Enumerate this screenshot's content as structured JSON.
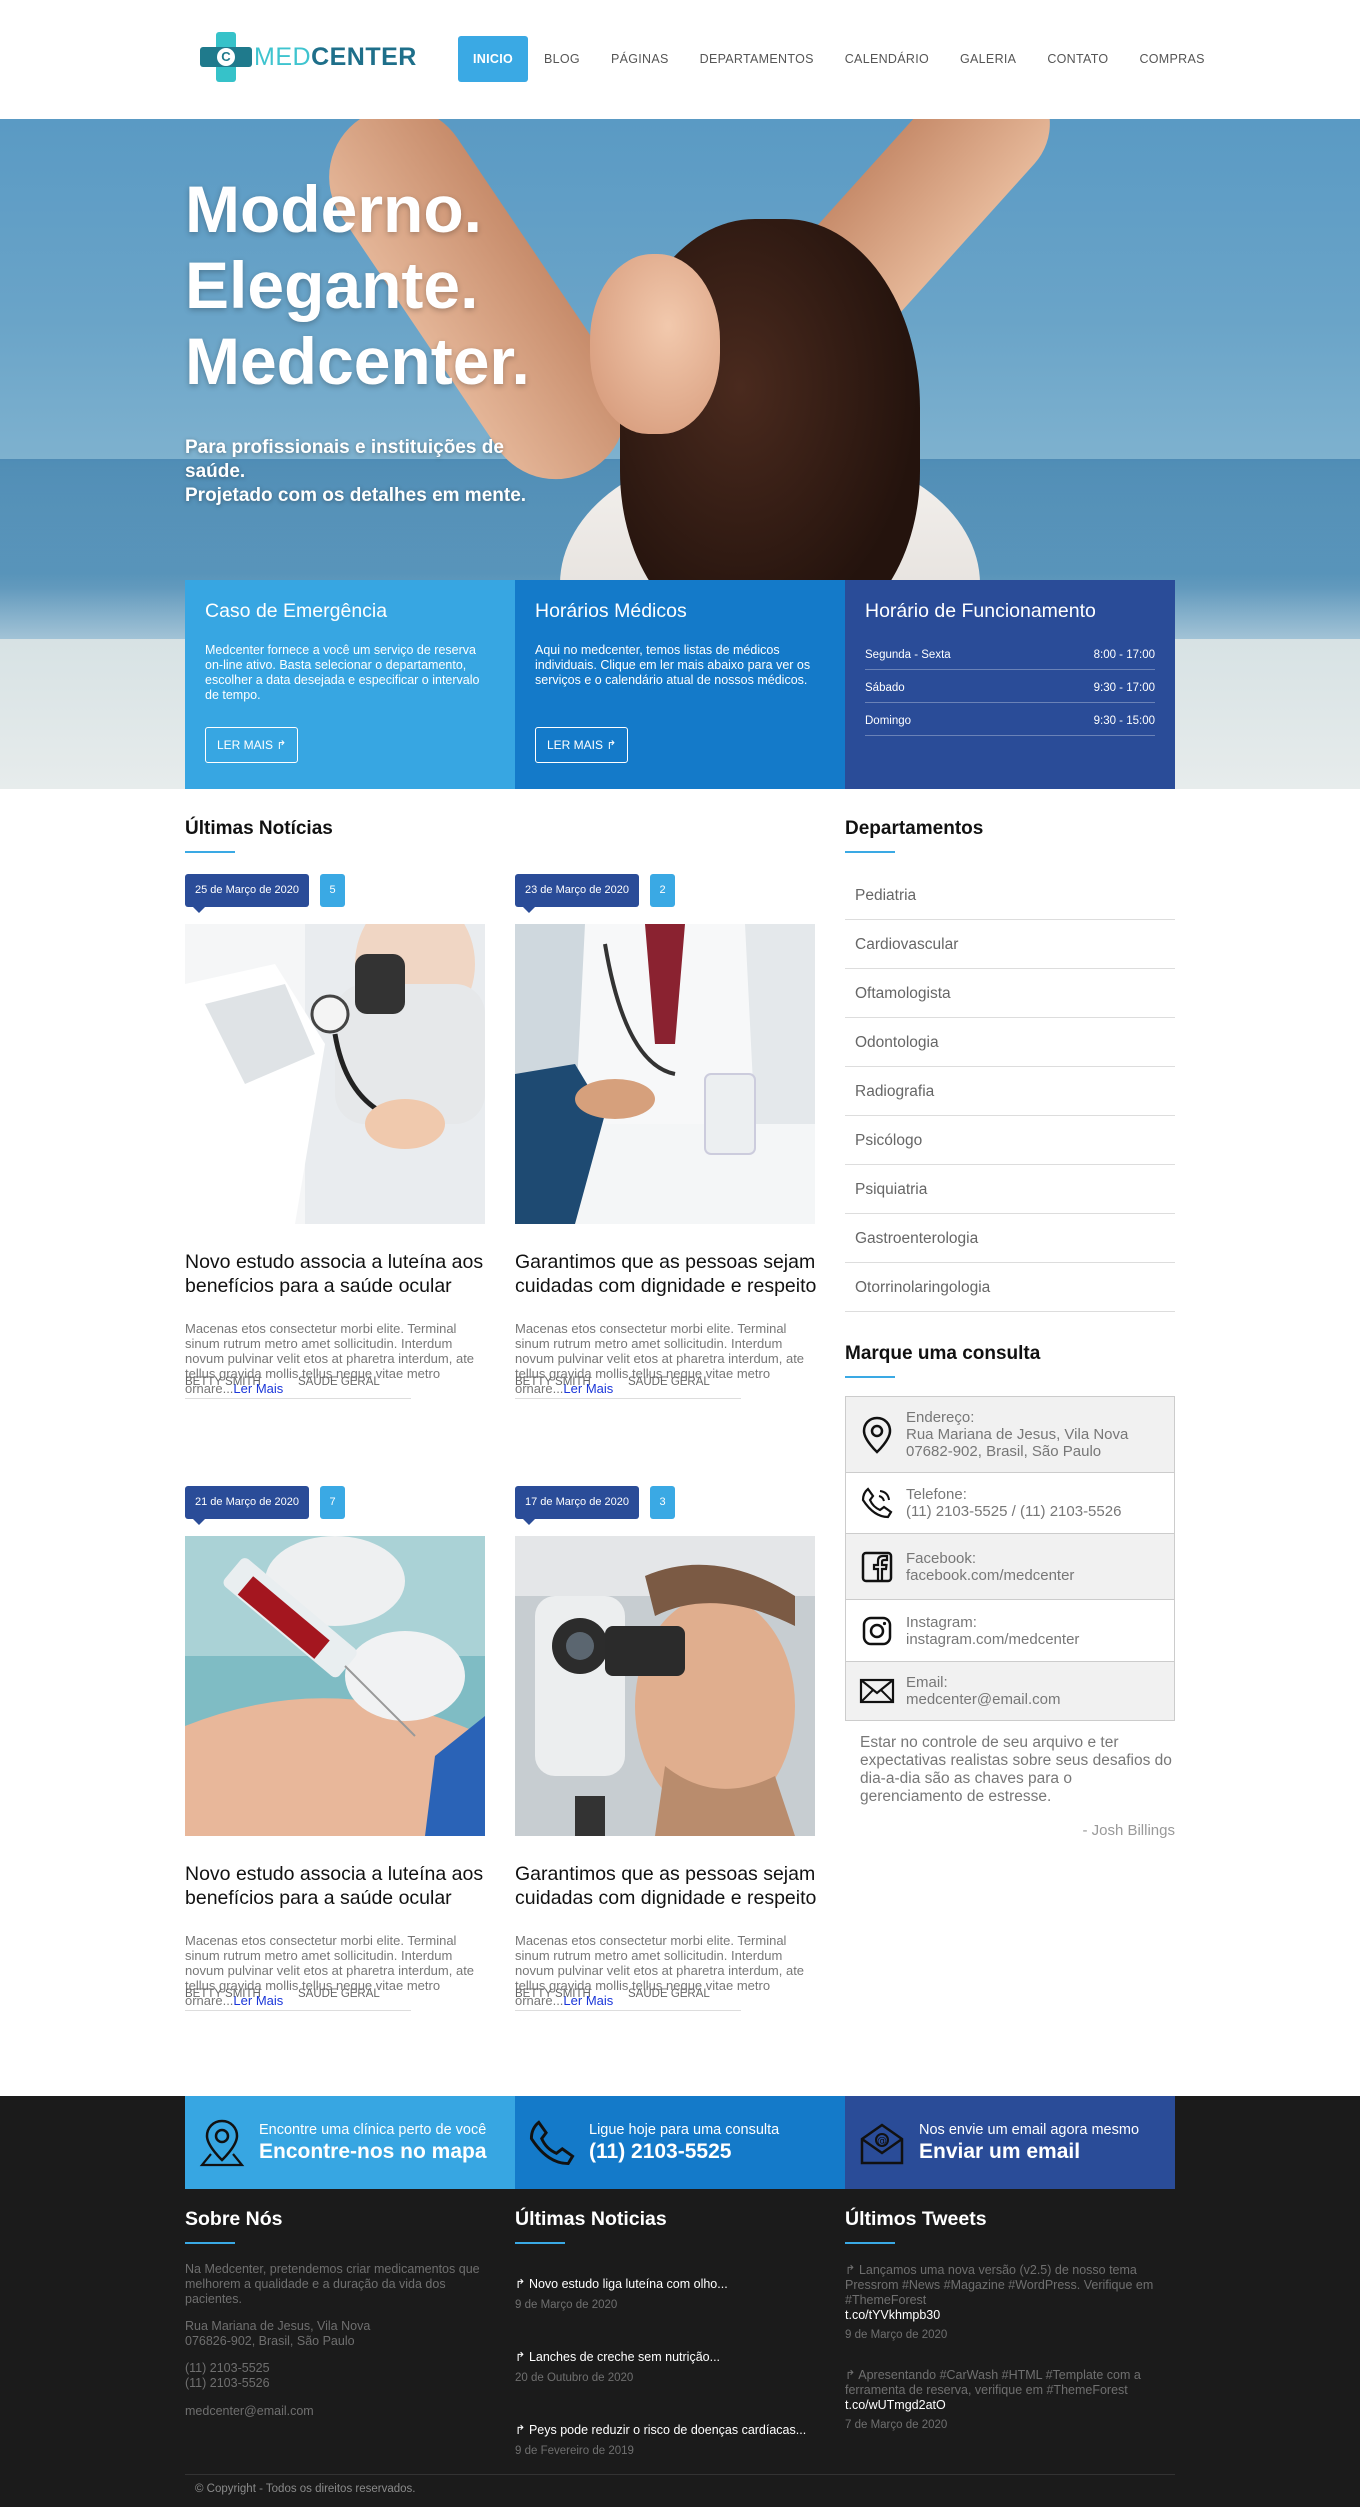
{
  "brand": {
    "logo_letter": "C",
    "name_part1": "MED",
    "name_part2": "CENTER"
  },
  "nav": [
    "INICIO",
    "BLOG",
    "PÁGINAS",
    "DEPARTAMENTOS",
    "CALENDÁRIO",
    "GALERIA",
    "CONTATO",
    "COMPRAS"
  ],
  "hero": {
    "title_lines": [
      "Moderno.",
      "Elegante.",
      "Medcenter."
    ],
    "subtitle_lines": [
      "Para profissionais e instituições de saúde.",
      "Projetado com os detalhes em mente."
    ]
  },
  "boxes": {
    "emergency": {
      "title": "Caso de Emergência",
      "text": "Medcenter fornece a você um serviço de reserva on-line ativo. Basta selecionar o departamento, escolher a data desejada e especificar o intervalo de tempo.",
      "button": "LER MAIS ↱"
    },
    "schedule": {
      "title": "Horários Médicos",
      "text": "Aqui no medcenter, temos listas de médicos individuais. Clique em ler mais abaixo para ver os serviços e o calendário atual de nossos médicos.",
      "button": "LER MAIS ↱"
    },
    "hours": {
      "title": "Horário de Funcionamento",
      "rows": [
        {
          "day": "Segunda - Sexta",
          "time": "8:00 - 17:00"
        },
        {
          "day": "Sábado",
          "time": "9:30 - 17:00"
        },
        {
          "day": "Domingo",
          "time": "9:30 - 15:00"
        }
      ]
    }
  },
  "news": {
    "heading": "Últimas Notícias",
    "posts": [
      {
        "date": "25 de Março de 2020",
        "comments": "5",
        "title": "Novo estudo associa a luteína aos benefícios para a saúde ocular",
        "excerpt": "Macenas etos consectetur morbi elite. Terminal sinum rutrum metro amet sollicitudin. Interdum novum pulvinar velit etos at pharetra interdum, ate tellus gravida mollis tellus neque vitae metro ornare...",
        "more": "Ler Mais",
        "author": "BETTY SMITH",
        "category": "SAÚDE GERAL"
      },
      {
        "date": "23 de Março de 2020",
        "comments": "2",
        "title": "Garantimos que as pessoas sejam cuidadas com dignidade e respeito",
        "excerpt": "Macenas etos consectetur morbi elite. Terminal sinum rutrum metro amet sollicitudin. Interdum novum pulvinar velit etos at pharetra interdum, ate tellus gravida mollis tellus neque vitae metro ornare...",
        "more": "Ler Mais",
        "author": "BETTY SMITH",
        "category": "SAÚDE GERAL"
      },
      {
        "date": "21 de Março de 2020",
        "comments": "7",
        "title": "Novo estudo associa a luteína aos benefícios para a saúde ocular",
        "excerpt": "Macenas etos consectetur morbi elite. Terminal sinum rutrum metro amet sollicitudin. Interdum novum pulvinar velit etos at pharetra interdum, ate tellus gravida mollis tellus neque vitae metro ornare...",
        "more": "Ler Mais",
        "author": "BETTY SMITH",
        "category": "SAÚDE GERAL"
      },
      {
        "date": "17 de Março de 2020",
        "comments": "3",
        "title": "Garantimos que as pessoas sejam cuidadas com dignidade e respeito",
        "excerpt": "Macenas etos consectetur morbi elite. Terminal sinum rutrum metro amet sollicitudin. Interdum novum pulvinar velit etos at pharetra interdum, ate tellus gravida mollis tellus neque vitae metro ornare...",
        "more": "Ler Mais",
        "author": "BETTY SMITH",
        "category": "SAÚDE GERAL"
      }
    ]
  },
  "departments": {
    "heading": "Departamentos",
    "items": [
      "Pediatria",
      "Cardiovascular",
      "Oftamologista",
      "Odontologia",
      "Radiografia",
      "Psicólogo",
      "Psiquiatria",
      "Gastroenterologia",
      "Otorrinolaringologia"
    ]
  },
  "contact": {
    "heading": "Marque uma consulta",
    "address_label": "Endereço:",
    "address_lines": [
      "Rua Mariana de Jesus, Vila Nova",
      "07682-902, Brasil, São Paulo"
    ],
    "phone_label": "Telefone:",
    "phone": "(11) 2103-5525 / (11) 2103-5526",
    "facebook_label": "Facebook:",
    "facebook": "facebook.com/medcenter",
    "instagram_label": "Instagram:",
    "instagram": "instagram.com/medcenter",
    "email_label": "Email:",
    "email": "medcenter@email.com",
    "quote": "Estar no controle de seu arquivo e ter expectativas realistas sobre seus desafios do dia-a-dia são as chaves para o gerenciamento de estresse.",
    "quote_author": "- Josh Billings"
  },
  "cta": [
    {
      "small": "Encontre uma clínica perto de você",
      "big": "Encontre-nos no mapa",
      "icon": "map-pin-icon"
    },
    {
      "small": "Ligue hoje para uma consulta",
      "big": "(11) 2103-5525",
      "icon": "phone-icon"
    },
    {
      "small": "Nos envie um email agora mesmo",
      "big": "Enviar um email",
      "icon": "mail-icon"
    }
  ],
  "footer": {
    "about": {
      "heading": "Sobre Nós",
      "text": "Na Medcenter, pretendemos criar medicamentos que melhorem a qualidade e a duração da vida dos pacientes.",
      "address": [
        "Rua Mariana de Jesus, Vila Nova",
        "076826-902, Brasil, São Paulo"
      ],
      "phones": [
        "(11) 2103-5525",
        "(11) 2103-5526"
      ],
      "email": "medcenter@email.com"
    },
    "news": {
      "heading": "Últimas Noticias",
      "items": [
        {
          "title": "↱ Novo estudo liga luteína com olho...",
          "date": "9 de Março de 2020"
        },
        {
          "title": "↱ Lanches de creche sem nutrição...",
          "date": "20 de Outubro de 2020"
        },
        {
          "title": "↱ Peys pode reduzir o risco de doenças cardíacas...",
          "date": "9 de Fevereiro de 2019"
        }
      ]
    },
    "tweets": {
      "heading": "Últimos Tweets",
      "items": [
        {
          "text": "↱ Lançamos uma nova versão (v2.5) de nosso tema Pressrom #News #Magazine #WordPress. Verifique em #ThemeForest",
          "link": "t.co/tYVkhmpb30",
          "date": "9 de Março de 2020"
        },
        {
          "text": "↱ Apresentando #CarWash #HTML #Template com a ferramenta de reserva, verifique em #ThemeForest",
          "link": "t.co/wUTmgd2atO",
          "date": "7 de Março de 2020"
        }
      ]
    },
    "copyright": "© Copyright - Todos os direitos reservados."
  }
}
